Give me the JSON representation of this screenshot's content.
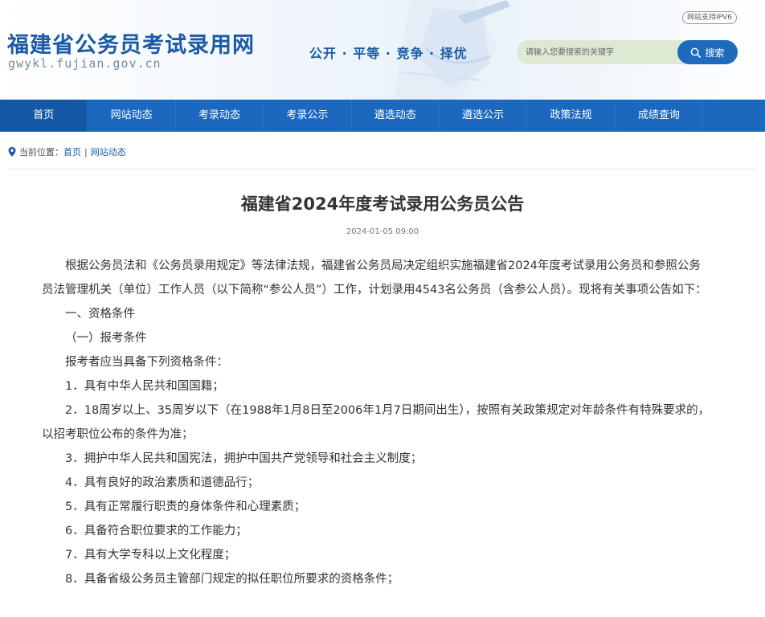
{
  "header": {
    "site_title": "福建省公务员考试录用网",
    "site_domain": "gwykl.fujian.gov.cn",
    "slogan": "公开 · 平等 · 竞争 · 择优",
    "ipv6_badge": "网站支持IPV6",
    "search": {
      "placeholder": "请输入您要搜索的关键字",
      "button_label": "搜索"
    }
  },
  "nav": {
    "items": [
      {
        "label": "首页",
        "active": true
      },
      {
        "label": "网站动态"
      },
      {
        "label": "考录动态"
      },
      {
        "label": "考录公示"
      },
      {
        "label": "遴选动态"
      },
      {
        "label": "遴选公示"
      },
      {
        "label": "政策法规"
      },
      {
        "label": "成绩查询"
      }
    ]
  },
  "breadcrumb": {
    "prefix": "当前位置：",
    "home": "首页",
    "separator": "|",
    "current": "网站动态"
  },
  "article": {
    "title": "福建省2024年度考试录用公务员公告",
    "date": "2024-01-05 09:00",
    "paragraphs": [
      "根据公务员法和《公务员录用规定》等法律法规，福建省公务员局决定组织实施福建省2024年度考试录用公务员和参照公务员法管理机关（单位）工作人员（以下简称“参公人员”）工作，计划录用4543名公务员（含参公人员）。现将有关事项公告如下：",
      "一、资格条件",
      "（一）报考条件",
      "报考者应当具备下列资格条件：",
      "1．具有中华人民共和国国籍；",
      "2．18周岁以上、35周岁以下（在1988年1月8日至2006年1月7日期间出生），按照有关政策规定对年龄条件有特殊要求的，以招考职位公布的条件为准；",
      "3．拥护中华人民共和国宪法，拥护中国共产党领导和社会主义制度；",
      "4．具有良好的政治素质和道德品行；",
      "5．具有正常履行职责的身体条件和心理素质；",
      "6．具备符合职位要求的工作能力；",
      "7．具有大学专科以上文化程度；",
      "8．具备省级公务员主管部门规定的拟任职位所要求的资格条件；"
    ]
  },
  "colors": {
    "brand_blue": "#1a5aa6",
    "nav_bg": "#1c68bf",
    "search_button": "#1e6bbd",
    "search_input_bg": "#dde9d2"
  }
}
